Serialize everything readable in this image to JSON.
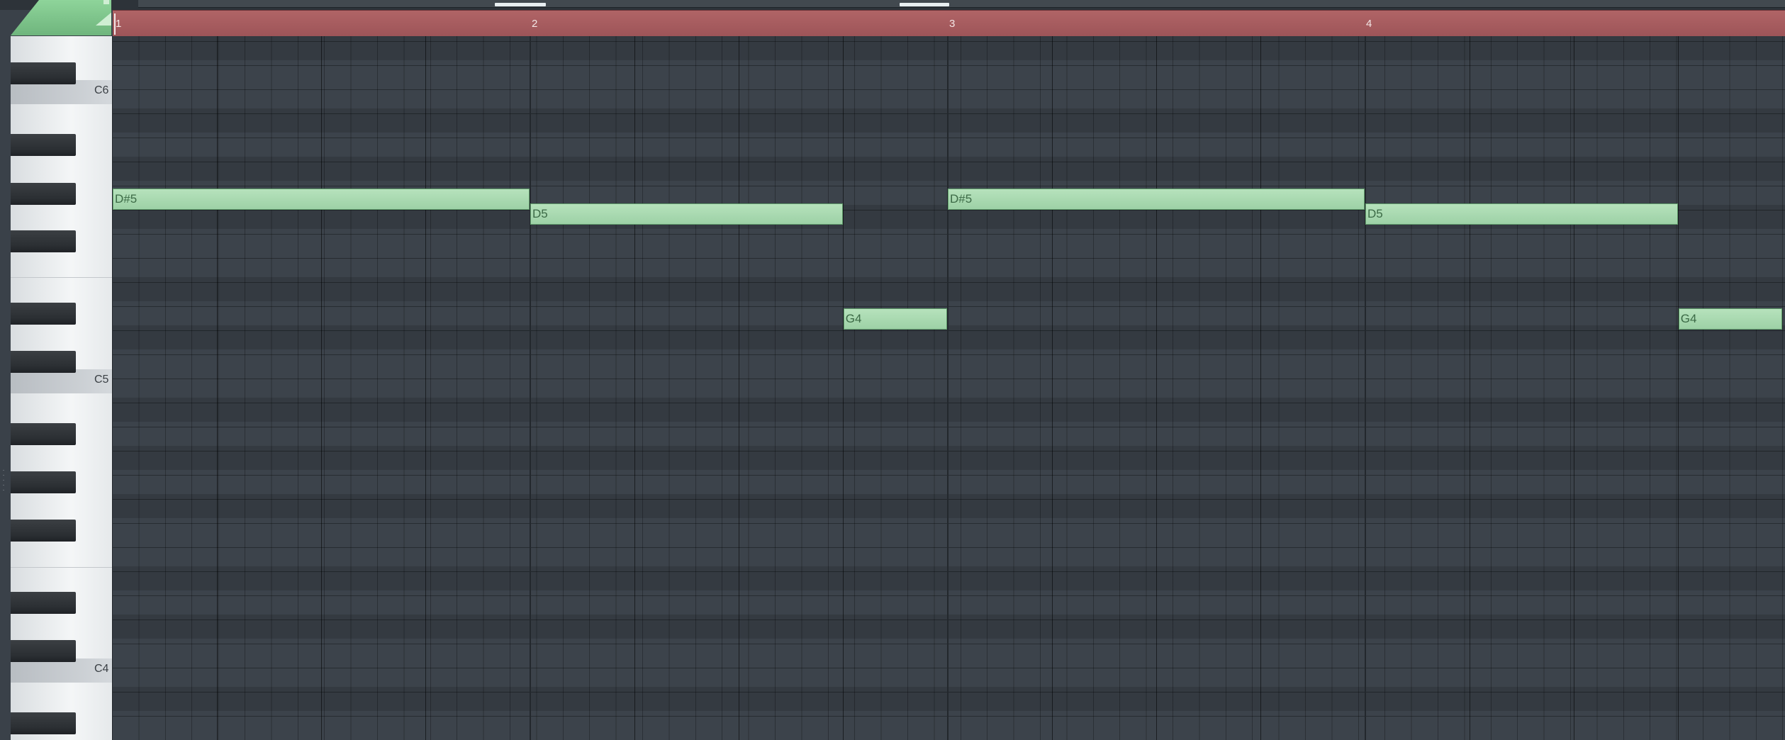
{
  "timeline": {
    "bars": [
      "1",
      "2",
      "3",
      "4"
    ]
  },
  "keyboard": {
    "octave_labels": [
      "C6",
      "C5",
      "C4"
    ]
  },
  "notes": [
    {
      "label": "D#5",
      "pitch": "D#5",
      "start_bar": 1.0,
      "length_bars": 1.0
    },
    {
      "label": "D5",
      "pitch": "D5",
      "start_bar": 2.0,
      "length_bars": 0.75
    },
    {
      "label": "G4",
      "pitch": "G4",
      "start_bar": 2.75,
      "length_bars": 0.25
    },
    {
      "label": "D#5",
      "pitch": "D#5",
      "start_bar": 3.0,
      "length_bars": 1.0
    },
    {
      "label": "D5",
      "pitch": "D5",
      "start_bar": 4.0,
      "length_bars": 0.75
    },
    {
      "label": "G4",
      "pitch": "G4",
      "start_bar": 4.75,
      "length_bars": 0.25
    }
  ],
  "colors": {
    "timeline": "#a85c60",
    "note_fill": "#a9d9b0",
    "grid": "#3c434b"
  }
}
